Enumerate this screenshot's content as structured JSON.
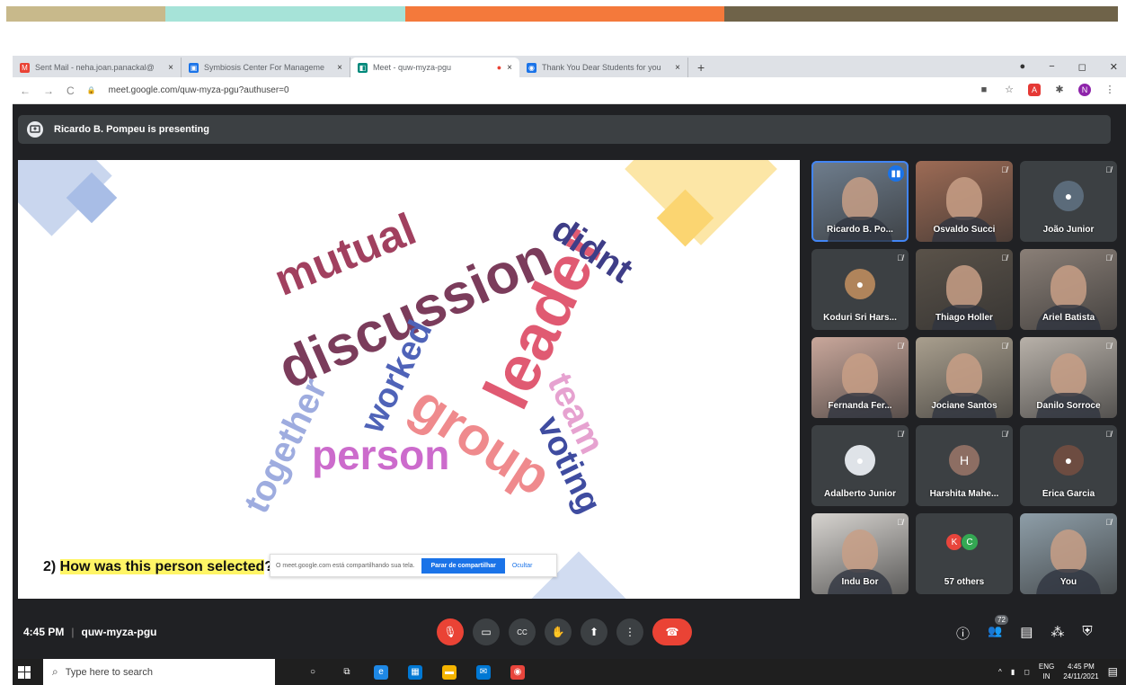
{
  "top_strip": {
    "colors": [
      "#c8b98b",
      "#a6e3d8",
      "#f4793b",
      "#6f6349"
    ]
  },
  "browser": {
    "tabs": [
      {
        "title": "Sent Mail - neha.joan.panackal@",
        "close": "×",
        "icon": "gmail-icon",
        "icon_glyph": "M",
        "color": "#ea4335"
      },
      {
        "title": "Symbiosis Center For Manageme",
        "close": "×",
        "icon": "sheet-icon",
        "icon_glyph": "▣",
        "color": "#1a73e8"
      },
      {
        "title": "Meet - quw-myza-pgu",
        "close": "×",
        "icon": "meet-icon",
        "icon_glyph": "◧",
        "color": "#00897b",
        "recording": "●"
      },
      {
        "title": "Thank You Dear Students for you",
        "close": "×",
        "icon": "chrome-icon",
        "icon_glyph": "◉",
        "color": "#1a73e8"
      }
    ],
    "new_tab": "+",
    "window_controls": {
      "record": "●",
      "minimize": "−",
      "maximize": "◻",
      "close": "✕"
    },
    "address": {
      "back": "←",
      "forward": "→",
      "reload": "C",
      "lock": "🔒",
      "url": "meet.google.com/quw-myza-pgu?authuser=0"
    },
    "toolbar_icons": [
      {
        "name": "extension-icon",
        "glyph": "■",
        "color": "#555"
      },
      {
        "name": "bookmark-star-icon",
        "glyph": "☆",
        "color": "#555"
      },
      {
        "name": "pdf-icon",
        "glyph": "A",
        "color": "#e53935"
      },
      {
        "name": "puzzle-icon",
        "glyph": "✱",
        "color": "#555"
      },
      {
        "name": "profile-icon",
        "glyph": "N",
        "color": "#8e24aa"
      },
      {
        "name": "menu-icon",
        "glyph": "⋮",
        "color": "#555"
      }
    ]
  },
  "meet": {
    "presenting": "Ricardo B. Pompeu is presenting",
    "slide": {
      "words": [
        {
          "text": "mutual",
          "color": "#a1405f"
        },
        {
          "text": "discussion",
          "color": "#7b3c5b"
        },
        {
          "text": "leader",
          "color": "#e05a72"
        },
        {
          "text": "didnt",
          "color": "#3e3d87"
        },
        {
          "text": "worked",
          "color": "#4f63b8"
        },
        {
          "text": "group",
          "color": "#ef8a8d"
        },
        {
          "text": "team",
          "color": "#e6a2d0"
        },
        {
          "text": "together",
          "color": "#9eacdf"
        },
        {
          "text": "person",
          "color": "#cc6bcc"
        },
        {
          "text": "voting",
          "color": "#3f4ca0"
        }
      ],
      "question_prefix": "2) ",
      "question_highlight": "How was this person selected",
      "question_suffix": "?"
    },
    "share_banner": {
      "text": "O meet.google.com está compartilhando sua tela.",
      "stop_button": "Parar de compartilhar",
      "hide": "Ocultar"
    },
    "participants": [
      {
        "name": "Ricardo B. Po...",
        "speaking": true,
        "type": "photo",
        "bg": "#6f7e8e"
      },
      {
        "name": "Osvaldo Succi",
        "type": "photo",
        "bg": "#9d6b55"
      },
      {
        "name": "João Junior",
        "type": "avatar",
        "avatar_color": "#5b6b7a",
        "glyph": "●"
      },
      {
        "name": "Koduri Sri Hars...",
        "type": "avatar",
        "avatar_color": "#b0845b",
        "glyph": "●"
      },
      {
        "name": "Thiago Holler",
        "type": "photo",
        "bg": "#5a5249"
      },
      {
        "name": "Ariel Batista",
        "type": "photo",
        "bg": "#8a7f77"
      },
      {
        "name": "Fernanda Fer...",
        "type": "photo",
        "bg": "#c9a79b"
      },
      {
        "name": "Jociane Santos",
        "type": "photo",
        "bg": "#a99f8e"
      },
      {
        "name": "Danilo Sorroce",
        "type": "photo",
        "bg": "#b8b1a9"
      },
      {
        "name": "Adalberto Junior",
        "type": "avatar",
        "avatar_color": "#dfe3e8",
        "glyph": "●"
      },
      {
        "name": "Harshita Mahe...",
        "type": "avatar",
        "avatar_color": "#8d6e63",
        "glyph": "H"
      },
      {
        "name": "Érica Garcia",
        "type": "avatar",
        "avatar_color": "#6d4c41",
        "glyph": "●"
      },
      {
        "name": "Indu Bor",
        "type": "photo",
        "bg": "#d7d4d0"
      },
      {
        "name": "57 others",
        "type": "others",
        "avatars": [
          {
            "letter": "K",
            "color": "#e8453c"
          },
          {
            "letter": "C",
            "color": "#34a853"
          }
        ]
      },
      {
        "name": "You",
        "type": "photo",
        "bg": "#8e9ea8"
      }
    ],
    "mic_off_glyph": "🎙̸",
    "speaking_glyph": "▮▮",
    "bottom": {
      "time": "4:45 PM",
      "meeting_code": "quw-myza-pgu",
      "controls": [
        {
          "name": "mic-off-icon",
          "glyph": "🎙",
          "kind": "red"
        },
        {
          "name": "camera-icon",
          "glyph": "▭",
          "kind": "normal"
        },
        {
          "name": "captions-icon",
          "glyph": "CC",
          "kind": "normal"
        },
        {
          "name": "raise-hand-icon",
          "glyph": "✋",
          "kind": "normal"
        },
        {
          "name": "present-icon",
          "glyph": "⬆",
          "kind": "normal"
        },
        {
          "name": "more-options-icon",
          "glyph": "⋮",
          "kind": "normal"
        },
        {
          "name": "end-call-icon",
          "glyph": "☎",
          "kind": "end"
        }
      ],
      "people_count": "72",
      "right_controls": [
        {
          "name": "info-icon",
          "glyph": "ⓘ"
        },
        {
          "name": "people-icon",
          "glyph": "👥"
        },
        {
          "name": "chat-icon",
          "glyph": "▤"
        },
        {
          "name": "activities-icon",
          "glyph": "⁂"
        },
        {
          "name": "host-controls-icon",
          "glyph": "⛨"
        }
      ]
    }
  },
  "taskbar": {
    "search_placeholder": "Type here to search",
    "icons": [
      {
        "name": "cortana-icon",
        "glyph": "○",
        "color": "transparent"
      },
      {
        "name": "task-view-icon",
        "glyph": "⧉",
        "color": "transparent"
      },
      {
        "name": "edge-icon",
        "glyph": "e",
        "color": "#1e88e5"
      },
      {
        "name": "store-icon",
        "glyph": "▦",
        "color": "#0078d4"
      },
      {
        "name": "file-explorer-icon",
        "glyph": "▬",
        "color": "#f4b400"
      },
      {
        "name": "mail-icon",
        "glyph": "✉",
        "color": "#0078d4"
      },
      {
        "name": "chrome-taskbar-icon",
        "glyph": "◉",
        "color": "#e8453c"
      }
    ],
    "tray": {
      "chevron": "^",
      "lang_top": "ENG",
      "lang_bottom": "IN",
      "time": "4:45 PM",
      "date": "24/11/2021",
      "notifications": "▤"
    }
  }
}
